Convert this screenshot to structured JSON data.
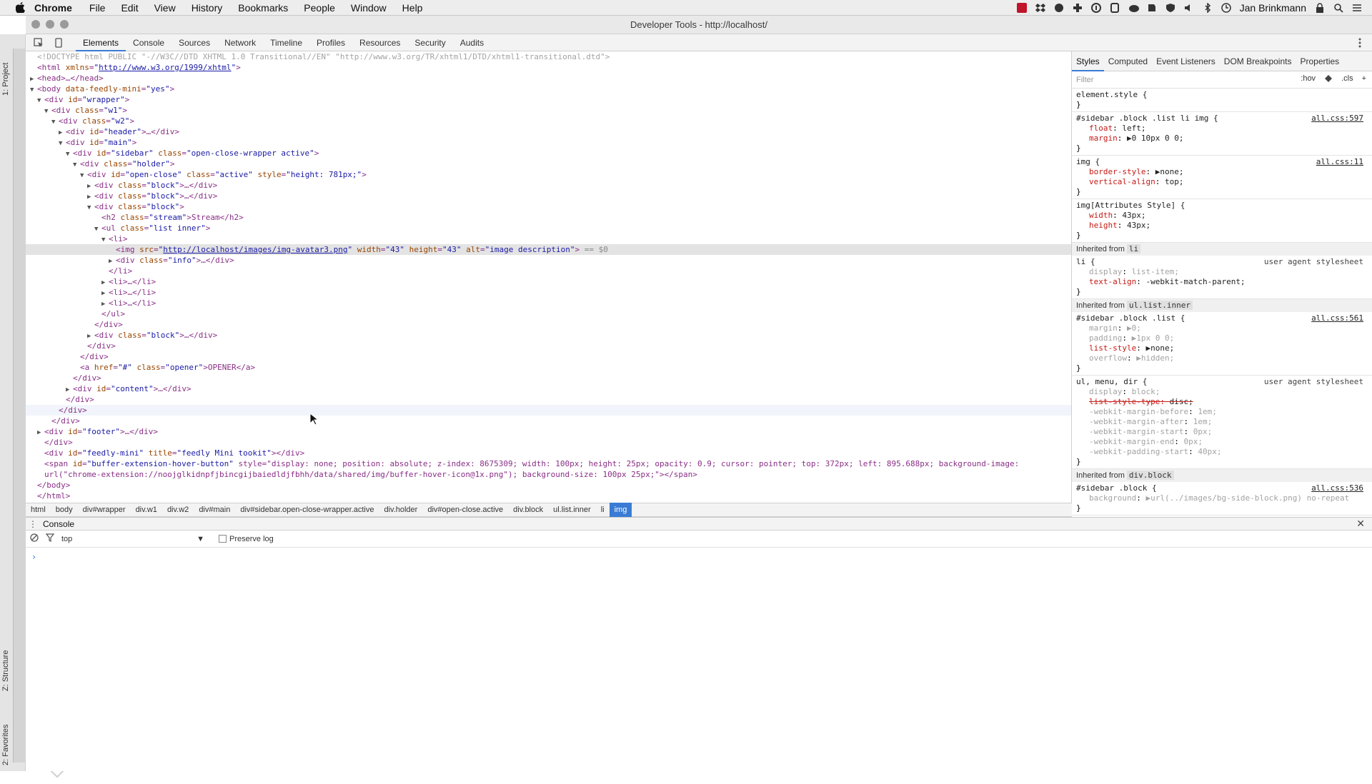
{
  "menubar": {
    "app": "Chrome",
    "items": [
      "File",
      "Edit",
      "View",
      "History",
      "Bookmarks",
      "People",
      "Window",
      "Help"
    ],
    "user": "Jan Brinkmann"
  },
  "window": {
    "title": "Developer Tools - http://localhost/"
  },
  "ide_strip": {
    "top_label": "1: Project",
    "structure_label": "Z: Structure",
    "favorites_label": "2: Favorites"
  },
  "toolbar": {
    "tabs": [
      "Elements",
      "Console",
      "Sources",
      "Network",
      "Timeline",
      "Profiles",
      "Resources",
      "Security",
      "Audits"
    ],
    "active": "Elements"
  },
  "dom": [
    {
      "indent": 0,
      "tw": "",
      "text": "<!DOCTYPE html PUBLIC \"-//W3C//DTD XHTML 1.0 Transitional//EN\" \"http://www.w3.org/TR/xhtml1/DTD/xhtml1-transitional.dtd\">",
      "cls": "doctype"
    },
    {
      "indent": 0,
      "tw": "",
      "text": "<html xmlns=\"http://www.w3.org/1999/xhtml\">"
    },
    {
      "indent": 0,
      "tw": "▶",
      "text": "<head>…</head>"
    },
    {
      "indent": 0,
      "tw": "▼",
      "text": "<body data-feedly-mini=\"yes\">"
    },
    {
      "indent": 1,
      "tw": "▼",
      "text": "<div id=\"wrapper\">"
    },
    {
      "indent": 2,
      "tw": "▼",
      "text": "<div class=\"w1\">"
    },
    {
      "indent": 3,
      "tw": "▼",
      "text": "<div class=\"w2\">"
    },
    {
      "indent": 4,
      "tw": "▶",
      "text": "<div id=\"header\">…</div>"
    },
    {
      "indent": 4,
      "tw": "▼",
      "text": "<div id=\"main\">"
    },
    {
      "indent": 5,
      "tw": "▼",
      "text": "<div id=\"sidebar\" class=\"open-close-wrapper active\">"
    },
    {
      "indent": 6,
      "tw": "▼",
      "text": "<div class=\"holder\">"
    },
    {
      "indent": 7,
      "tw": "▼",
      "text": "<div id=\"open-close\" class=\"active\" style=\"height: 781px;\">"
    },
    {
      "indent": 8,
      "tw": "▶",
      "text": "<div class=\"block\">…</div>"
    },
    {
      "indent": 8,
      "tw": "▶",
      "text": "<div class=\"block\">…</div>"
    },
    {
      "indent": 8,
      "tw": "▼",
      "text": "<div class=\"block\">"
    },
    {
      "indent": 9,
      "tw": "",
      "text": "<h2 class=\"stream\">Stream</h2>"
    },
    {
      "indent": 9,
      "tw": "▼",
      "text": "<ul class=\"list inner\">"
    },
    {
      "indent": 10,
      "tw": "▼",
      "text": "<li>"
    },
    {
      "indent": 11,
      "tw": "",
      "text": "<img src=\"http://localhost/images/img-avatar3.png\" width=\"43\" height=\"43\" alt=\"image description\"> == $0",
      "sel": true
    },
    {
      "indent": 11,
      "tw": "▶",
      "text": "<div class=\"info\">…</div>"
    },
    {
      "indent": 10,
      "tw": "",
      "text": "</li>"
    },
    {
      "indent": 10,
      "tw": "▶",
      "text": "<li>…</li>"
    },
    {
      "indent": 10,
      "tw": "▶",
      "text": "<li>…</li>"
    },
    {
      "indent": 10,
      "tw": "▶",
      "text": "<li>…</li>"
    },
    {
      "indent": 9,
      "tw": "",
      "text": "</ul>"
    },
    {
      "indent": 8,
      "tw": "",
      "text": "</div>"
    },
    {
      "indent": 8,
      "tw": "▶",
      "text": "<div class=\"block\">…</div>"
    },
    {
      "indent": 7,
      "tw": "",
      "text": "</div>"
    },
    {
      "indent": 6,
      "tw": "",
      "text": "</div>"
    },
    {
      "indent": 6,
      "tw": "",
      "text": "<a href=\"#\" class=\"opener\">OPENER</a>"
    },
    {
      "indent": 5,
      "tw": "",
      "text": "</div>"
    },
    {
      "indent": 5,
      "tw": "▶",
      "text": "<div id=\"content\">…</div>"
    },
    {
      "indent": 4,
      "tw": "",
      "text": "</div>"
    },
    {
      "indent": 3,
      "tw": "",
      "text": "</div>",
      "hov": true
    },
    {
      "indent": 2,
      "tw": "",
      "text": "</div>"
    },
    {
      "indent": 1,
      "tw": "▶",
      "text": "<div id=\"footer\">…</div>"
    },
    {
      "indent": 1,
      "tw": "",
      "text": "</div>"
    },
    {
      "indent": 1,
      "tw": "",
      "text": "<div id=\"feedly-mini\" title=\"feedly Mini tookit\"></div>"
    },
    {
      "indent": 1,
      "tw": "",
      "text": "<span id=\"buffer-extension-hover-button\" style=\"display: none; position: absolute; z-index: 8675309; width: 100px; height: 25px; opacity: 0.9; cursor: pointer; top: 372px; left: 895.688px; background-image:"
    },
    {
      "indent": 1,
      "tw": "",
      "text": "url(\"chrome-extension://noojglkidnpfjbincgijbaiedldjfbhh/data/shared/img/buffer-hover-icon@1x.png\"); background-size: 100px 25px;\"></span>"
    },
    {
      "indent": 0,
      "tw": "",
      "text": "</body>"
    },
    {
      "indent": 0,
      "tw": "",
      "text": "</html>"
    }
  ],
  "breadcrumbs": [
    "html",
    "body",
    "div#wrapper",
    "div.w1",
    "div.w2",
    "div#main",
    "div#sidebar.open-close-wrapper.active",
    "div.holder",
    "div#open-close.active",
    "div.block",
    "ul.list.inner",
    "li",
    "img"
  ],
  "styles": {
    "tabs": [
      "Styles",
      "Computed",
      "Event Listeners",
      "DOM Breakpoints",
      "Properties"
    ],
    "filter_placeholder": "Filter",
    "hov": ":hov",
    "cls": ".cls",
    "rules": [
      {
        "selector": "element.style {",
        "src": "",
        "ua": false,
        "decls": []
      },
      {
        "selector": "#sidebar .block .list li img {",
        "src": "all.css:597",
        "ua": false,
        "decls": [
          {
            "n": "float",
            "v": "left;"
          },
          {
            "n": "margin",
            "v": "▶0 10px 0 0;"
          }
        ]
      },
      {
        "selector": "img {",
        "src": "all.css:11",
        "ua": false,
        "decls": [
          {
            "n": "border-style",
            "v": "▶none;"
          },
          {
            "n": "vertical-align",
            "v": "top;"
          }
        ]
      },
      {
        "selector": "img[Attributes Style] {",
        "src": "",
        "ua": false,
        "decls": [
          {
            "n": "width",
            "v": "43px;"
          },
          {
            "n": "height",
            "v": "43px;"
          }
        ]
      },
      {
        "inherited": "li"
      },
      {
        "selector": "li {",
        "src": "user agent stylesheet",
        "ua": true,
        "decls": [
          {
            "n": "display",
            "v": "list-item;",
            "inh": true
          },
          {
            "n": "text-align",
            "v": "-webkit-match-parent;"
          }
        ]
      },
      {
        "inherited": "ul.list.inner"
      },
      {
        "selector": "#sidebar .block .list {",
        "src": "all.css:561",
        "ua": false,
        "decls": [
          {
            "n": "margin",
            "v": "▶0;",
            "inh": true
          },
          {
            "n": "padding",
            "v": "▶1px 0 0;",
            "inh": true
          },
          {
            "n": "list-style",
            "v": "▶none;"
          },
          {
            "n": "overflow",
            "v": "▶hidden;",
            "inh": true
          }
        ]
      },
      {
        "selector": "ul, menu, dir {",
        "src": "user agent stylesheet",
        "ua": true,
        "decls": [
          {
            "n": "display",
            "v": "block;",
            "inh": true
          },
          {
            "n": "list-style-type",
            "v": "disc;",
            "strike": true
          },
          {
            "n": "-webkit-margin-before",
            "v": "1em;",
            "inh": true
          },
          {
            "n": "-webkit-margin-after",
            "v": "1em;",
            "inh": true
          },
          {
            "n": "-webkit-margin-start",
            "v": "0px;",
            "inh": true
          },
          {
            "n": "-webkit-margin-end",
            "v": "0px;",
            "inh": true
          },
          {
            "n": "-webkit-padding-start",
            "v": "40px;",
            "inh": true
          }
        ]
      },
      {
        "inherited": "div.block"
      },
      {
        "selector": "#sidebar .block {",
        "src": "all.css:536",
        "ua": false,
        "decls": [
          {
            "n": "background",
            "v": "▶url(../images/bg-side-block.png) no-repeat",
            "inh": true
          }
        ]
      }
    ]
  },
  "console": {
    "title": "Console",
    "context": "top",
    "preserve_log": "Preserve log",
    "prompt": "›"
  },
  "colors": {
    "accent": "#3a7bd5",
    "tag": "#8a2f87",
    "attr_name": "#994500",
    "attr_value": "#1a1aa6"
  }
}
